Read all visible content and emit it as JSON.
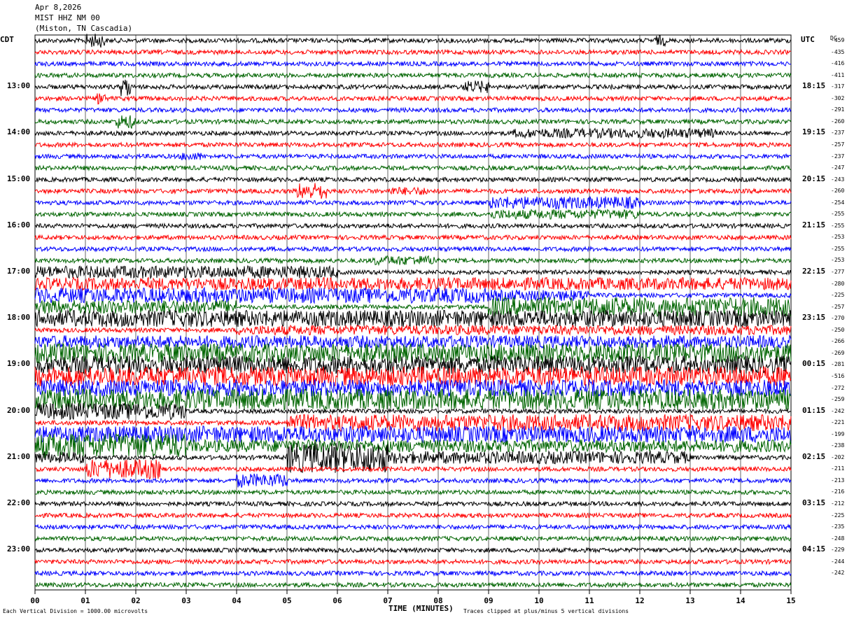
{
  "header": {
    "date": "Apr 8,2026",
    "station": "MIST HHZ NM 00",
    "location": "(Miston, TN Cascadia)"
  },
  "left_zone": "CDT",
  "right_zone": "UTC",
  "dc_header": "DC",
  "chart_data": {
    "type": "line",
    "title": "MIST HHZ NM 00",
    "xlabel": "TIME (MINUTES)",
    "x_range": [
      0,
      15
    ],
    "x_ticks": [
      "00",
      "01",
      "02",
      "03",
      "04",
      "05",
      "06",
      "07",
      "08",
      "09",
      "10",
      "11",
      "12",
      "13",
      "14",
      "15"
    ],
    "left_time_labels": [
      "13:00",
      "14:00",
      "15:00",
      "16:00",
      "17:00",
      "18:00",
      "19:00",
      "20:00",
      "21:00",
      "22:00",
      "23:00"
    ],
    "right_time_labels": [
      "18:15",
      "19:15",
      "20:15",
      "21:15",
      "22:15",
      "23:15",
      "00:15",
      "01:15",
      "02:15",
      "03:15",
      "04:15"
    ],
    "trace_colors": [
      "#000000",
      "#ff0000",
      "#0000ff",
      "#006400"
    ],
    "traces_per_hour": 4,
    "trace_count": 48,
    "dc_offsets": [
      "-459",
      "-435",
      "-416",
      "-411",
      "-317",
      "-302",
      "-291",
      "-260",
      "-237",
      "-257",
      "-237",
      "-247",
      "-243",
      "-260",
      "-254",
      "-255",
      "-255",
      "-253",
      "-255",
      "-253",
      "-277",
      "-280",
      "-225",
      "-257",
      "-270",
      "-250",
      "-266",
      "-269",
      "-281",
      "-516",
      "-272",
      "-259",
      "-242",
      "-221",
      "-199",
      "-238",
      "-202",
      "-211",
      "-213",
      "-216",
      "-212",
      "-225",
      "-235",
      "-248",
      "-229",
      "-244",
      "-242"
    ],
    "clip_limit_divisions": 5
  },
  "footer": {
    "scale_note": "Each Vertical Division = 1000.00 microvolts",
    "clip_note": "Traces clipped at plus/minus 5 vertical divisions"
  }
}
